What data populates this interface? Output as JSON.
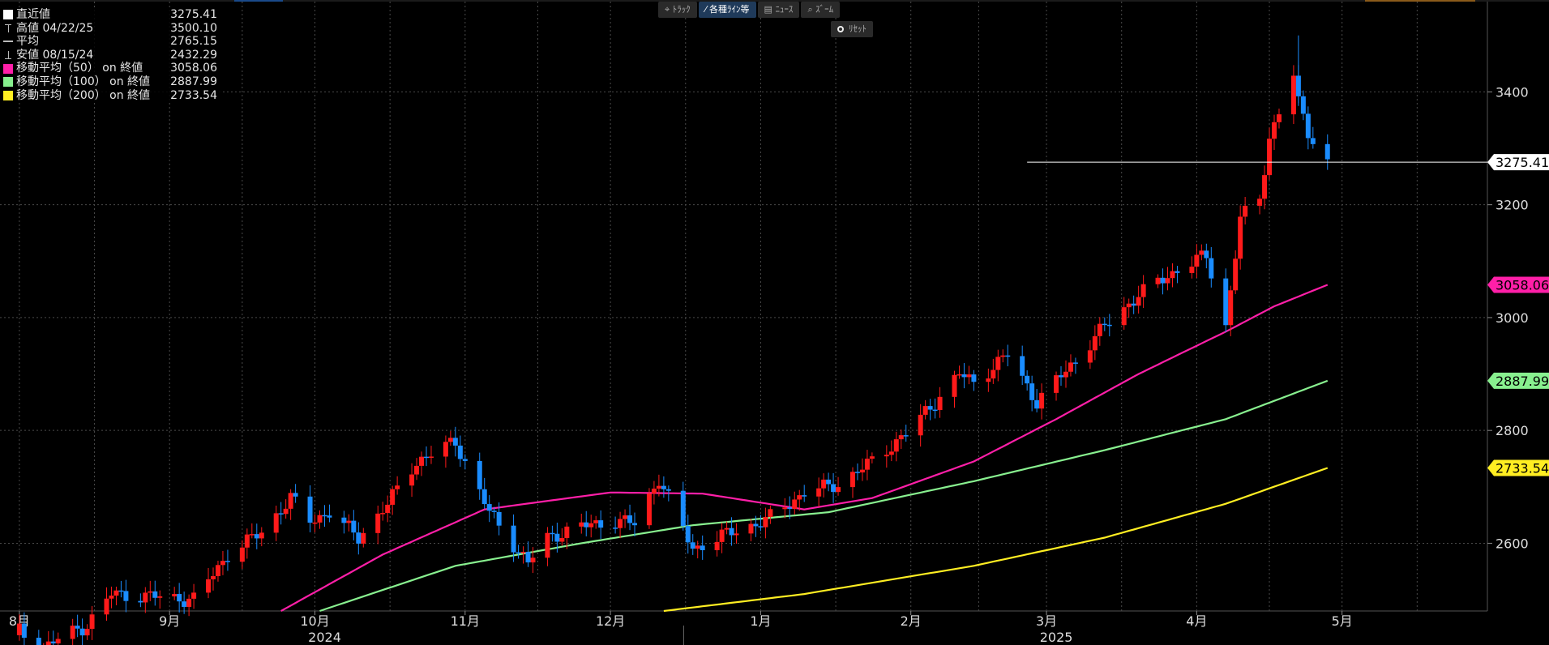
{
  "legend": {
    "items": [
      {
        "label": "直近値",
        "value": "3275.41",
        "color": "#ffffff",
        "marker": "square"
      },
      {
        "label": "高値 04/22/25",
        "value": "3500.10",
        "color": "#bbbbbb",
        "marker": "tick-high"
      },
      {
        "label": "平均",
        "value": "2765.15",
        "color": "#bbbbbb",
        "marker": "tick-avg"
      },
      {
        "label": "安値 08/15/24",
        "value": "2432.29",
        "color": "#bbbbbb",
        "marker": "tick-low"
      },
      {
        "label": "移動平均（50） on 終値",
        "value": "3058.06",
        "color": "#ff1fa8",
        "marker": "square"
      },
      {
        "label": "移動平均（100） on 終値",
        "value": "2887.99",
        "color": "#88f08f",
        "marker": "square"
      },
      {
        "label": "移動平均（200） on 終値",
        "value": "2733.54",
        "color": "#ffee22",
        "marker": "square"
      }
    ]
  },
  "toolbar": {
    "track_label": "ﾄﾗｯｸ",
    "lines_label": "各種ﾗｲﾝ等",
    "news_label": "ﾆｭｰｽ",
    "zoom_label": "ｽﾞｰﾑ",
    "reset_label": "ﾘｾｯﾄ"
  },
  "colors": {
    "up": "#ff1a1a",
    "down": "#1a8cff",
    "ma50": "#ff1fa8",
    "ma100": "#88f08f",
    "ma200": "#ffee22",
    "grid": "#4a4a4a",
    "last_line": "#ffffff"
  },
  "chart_data": {
    "type": "candlestick",
    "ylim": [
      2480,
      3560
    ],
    "yticks": [
      2600,
      2800,
      3000,
      3200,
      3400
    ],
    "x_start": "2024-08-01",
    "x_end": "2025-05-31",
    "month_labels": [
      {
        "date": "2024-08-01",
        "label": "8月"
      },
      {
        "date": "2024-09-01",
        "label": "9月"
      },
      {
        "date": "2024-10-01",
        "label": "10月"
      },
      {
        "date": "2024-11-01",
        "label": "11月"
      },
      {
        "date": "2024-12-01",
        "label": "12月"
      },
      {
        "date": "2025-01-01",
        "label": "1月"
      },
      {
        "date": "2025-02-01",
        "label": "2月"
      },
      {
        "date": "2025-03-01",
        "label": "3月"
      },
      {
        "date": "2025-04-01",
        "label": "4月"
      },
      {
        "date": "2025-05-01",
        "label": "5月"
      }
    ],
    "year_labels": [
      {
        "date": "2024-10-01",
        "label": "2024"
      },
      {
        "date": "2025-03-01",
        "label": "2025"
      }
    ],
    "year_divider": "2025-01-01",
    "last_value": 3275.41,
    "last_value_start": "2025-02-25",
    "high": {
      "date": "2025-04-22",
      "value": 3500.1
    },
    "low": {
      "date": "2024-08-15",
      "value": 2432.29
    },
    "average": 2765.15,
    "ma_end_labels": [
      {
        "name": "移動平均（50）",
        "value": 3058.06,
        "label": "3058.06"
      },
      {
        "name": "移動平均（100）",
        "value": 2887.99,
        "label": "2887.99"
      },
      {
        "name": "移動平均（200）",
        "value": 2733.54,
        "label": "2733.54"
      }
    ],
    "last_label": "3275.41",
    "close_anchors": [
      [
        "2024-08-01",
        2445
      ],
      [
        "2024-08-05",
        2410
      ],
      [
        "2024-08-09",
        2430
      ],
      [
        "2024-08-15",
        2455
      ],
      [
        "2024-08-20",
        2510
      ],
      [
        "2024-08-30",
        2505
      ],
      [
        "2024-09-06",
        2500
      ],
      [
        "2024-09-13",
        2580
      ],
      [
        "2024-09-20",
        2620
      ],
      [
        "2024-09-26",
        2680
      ],
      [
        "2024-09-30",
        2640
      ],
      [
        "2024-10-04",
        2655
      ],
      [
        "2024-10-10",
        2610
      ],
      [
        "2024-10-16",
        2670
      ],
      [
        "2024-10-22",
        2745
      ],
      [
        "2024-10-30",
        2780
      ],
      [
        "2024-11-06",
        2655
      ],
      [
        "2024-11-14",
        2565
      ],
      [
        "2024-11-18",
        2610
      ],
      [
        "2024-11-25",
        2630
      ],
      [
        "2024-12-02",
        2640
      ],
      [
        "2024-12-06",
        2635
      ],
      [
        "2024-12-11",
        2715
      ],
      [
        "2024-12-18",
        2590
      ],
      [
        "2024-12-26",
        2620
      ],
      [
        "2025-01-02",
        2640
      ],
      [
        "2025-01-10",
        2690
      ],
      [
        "2025-01-17",
        2705
      ],
      [
        "2025-01-24",
        2745
      ],
      [
        "2025-01-31",
        2795
      ],
      [
        "2025-02-07",
        2860
      ],
      [
        "2025-02-11",
        2900
      ],
      [
        "2025-02-14",
        2885
      ],
      [
        "2025-02-21",
        2935
      ],
      [
        "2025-02-27",
        2850
      ],
      [
        "2025-03-06",
        2915
      ],
      [
        "2025-03-13",
        2985
      ],
      [
        "2025-03-20",
        3040
      ],
      [
        "2025-03-28",
        3085
      ],
      [
        "2025-04-03",
        3110
      ],
      [
        "2025-04-07",
        2985
      ],
      [
        "2025-04-10",
        3175
      ],
      [
        "2025-04-14",
        3210
      ],
      [
        "2025-04-16",
        3320
      ],
      [
        "2025-04-21",
        3430
      ],
      [
        "2025-04-22",
        3380
      ],
      [
        "2025-04-24",
        3330
      ],
      [
        "2025-04-28",
        3275.41
      ]
    ],
    "ma50_anchors": [
      [
        "2024-09-24",
        2480
      ],
      [
        "2024-10-15",
        2580
      ],
      [
        "2024-11-05",
        2660
      ],
      [
        "2024-12-01",
        2690
      ],
      [
        "2024-12-20",
        2688
      ],
      [
        "2025-01-10",
        2660
      ],
      [
        "2025-01-24",
        2680
      ],
      [
        "2025-02-14",
        2745
      ],
      [
        "2025-03-03",
        2820
      ],
      [
        "2025-03-20",
        2900
      ],
      [
        "2025-04-07",
        2975
      ],
      [
        "2025-04-17",
        3020
      ],
      [
        "2025-04-28",
        3058.06
      ]
    ],
    "ma100_anchors": [
      [
        "2024-10-02",
        2480
      ],
      [
        "2024-10-30",
        2560
      ],
      [
        "2024-11-25",
        2600
      ],
      [
        "2024-12-18",
        2632
      ],
      [
        "2025-01-15",
        2655
      ],
      [
        "2025-02-14",
        2710
      ],
      [
        "2025-03-13",
        2765
      ],
      [
        "2025-04-07",
        2820
      ],
      [
        "2025-04-28",
        2887.99
      ]
    ],
    "ma200_anchors": [
      [
        "2024-12-12",
        2480
      ],
      [
        "2025-01-10",
        2510
      ],
      [
        "2025-02-14",
        2560
      ],
      [
        "2025-03-13",
        2610
      ],
      [
        "2025-04-07",
        2670
      ],
      [
        "2025-04-28",
        2733.54
      ]
    ]
  }
}
